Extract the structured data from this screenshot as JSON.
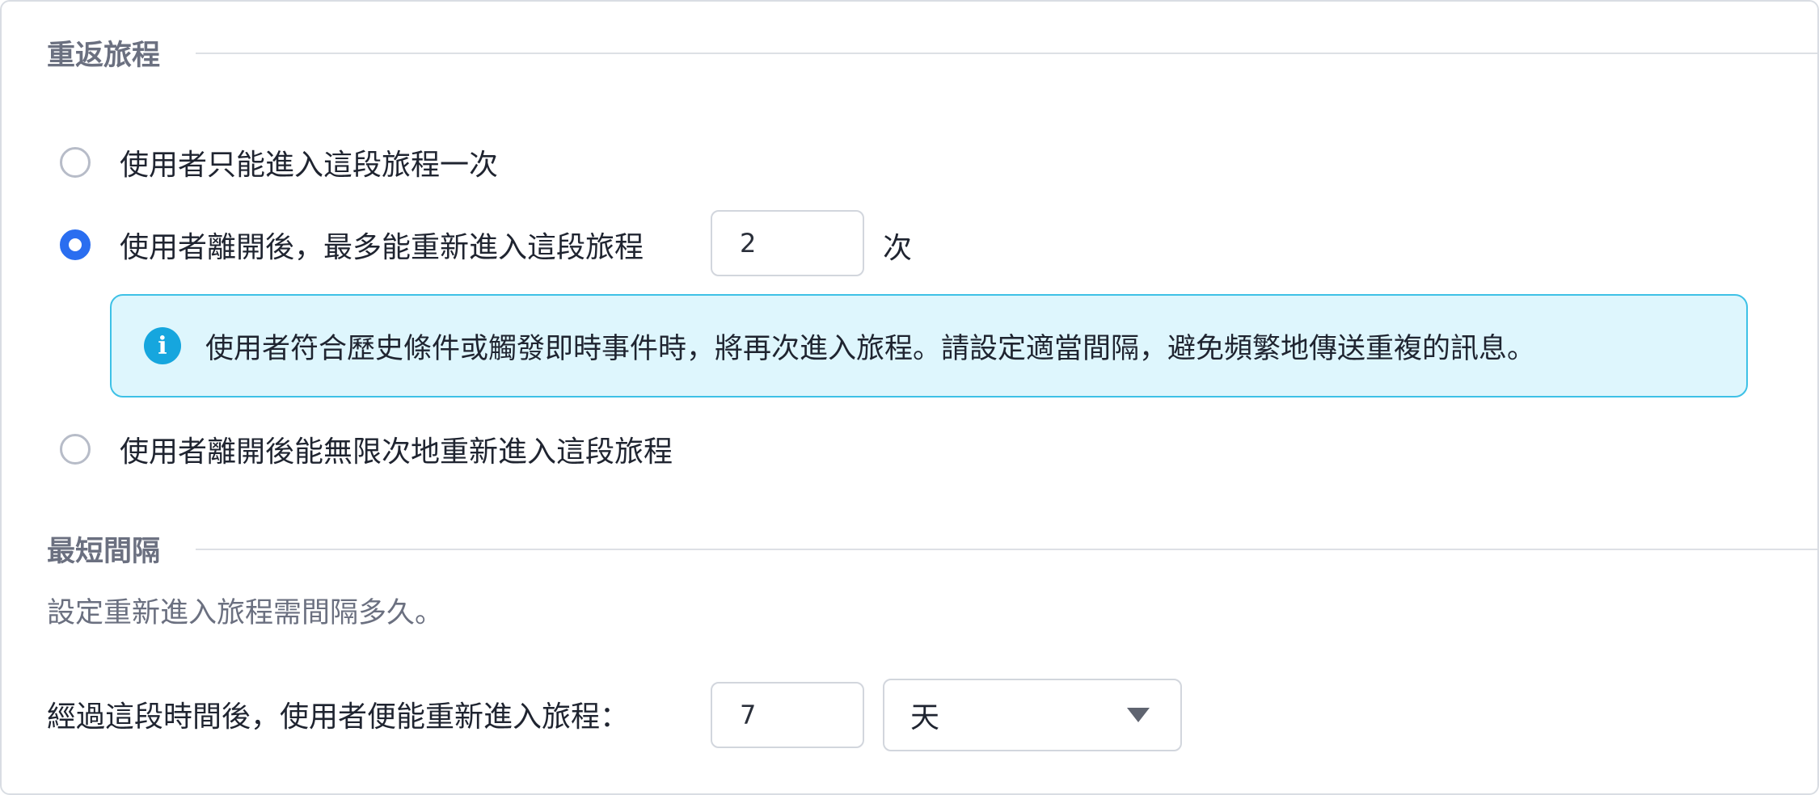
{
  "reentry": {
    "title": "重返旅程",
    "options": [
      {
        "label": "使用者只能進入這段旅程一次",
        "selected": false
      },
      {
        "label": "使用者離開後，最多能重新進入這段旅程",
        "selected": true,
        "count": "2",
        "suffix": "次"
      },
      {
        "label": "使用者離開後能無限次地重新進入這段旅程",
        "selected": false
      }
    ],
    "info": "使用者符合歷史條件或觸發即時事件時，將再次進入旅程。請設定適當間隔，避免頻繁地傳送重複的訊息。",
    "info_icon": "info-icon"
  },
  "interval": {
    "title": "最短間隔",
    "description": "設定重新進入旅程需間隔多久。",
    "label": "經過這段時間後，使用者便能重新進入旅程：",
    "value": "7",
    "unit": "天",
    "unit_icon": "caret-down-icon"
  },
  "colors": {
    "accent": "#2a6ef0",
    "info_bg": "#def6fd",
    "info_border": "#3ec1e6",
    "info_icon": "#16a6de",
    "muted_text": "#6b7080"
  }
}
